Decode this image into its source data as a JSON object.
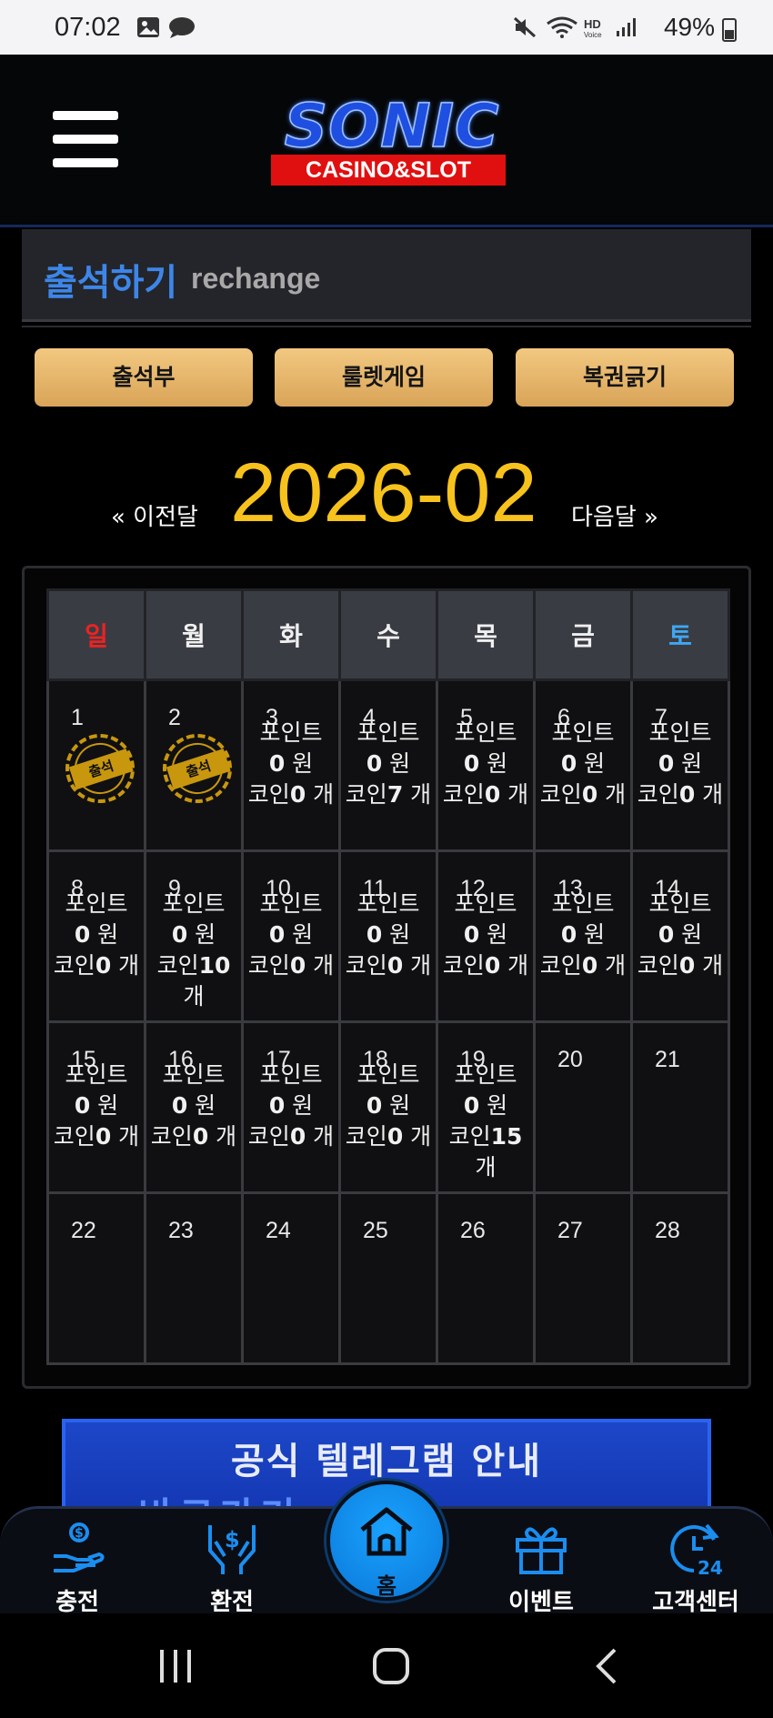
{
  "status_bar": {
    "time": "07:02",
    "battery": "49%",
    "icons": [
      "image-icon",
      "chat-icon",
      "mute-icon",
      "wifi-icon",
      "hd-voice-icon",
      "signal-icon",
      "battery-icon"
    ]
  },
  "header": {
    "menu_icon": "hamburger-menu-icon",
    "logo_main": "SONIC",
    "logo_sub": "CASINO&SLOT"
  },
  "page": {
    "title": "출석하기",
    "subtitle": "rechange"
  },
  "tabs": [
    {
      "label": "출석부"
    },
    {
      "label": "룰렛게임"
    },
    {
      "label": "복권긁기"
    }
  ],
  "month_nav": {
    "prev": "« 이전달",
    "current": "2026-02",
    "next": "다음달 »"
  },
  "calendar": {
    "weekdays": [
      "일",
      "월",
      "화",
      "수",
      "목",
      "금",
      "토"
    ],
    "days": {
      "d1": {
        "num": "1",
        "stamp": "출석"
      },
      "d2": {
        "num": "2",
        "stamp": "출석"
      },
      "d3": {
        "num": "3",
        "point_label": "포인트",
        "point": "0",
        "point_unit": "원",
        "coin_label": "코인",
        "coin": "0",
        "coin_unit": "개"
      },
      "d4": {
        "num": "4",
        "point_label": "포인트",
        "point": "0",
        "point_unit": "원",
        "coin_label": "코인",
        "coin": "7",
        "coin_unit": "개"
      },
      "d5": {
        "num": "5",
        "point_label": "포인트",
        "point": "0",
        "point_unit": "원",
        "coin_label": "코인",
        "coin": "0",
        "coin_unit": "개"
      },
      "d6": {
        "num": "6",
        "point_label": "포인트",
        "point": "0",
        "point_unit": "원",
        "coin_label": "코인",
        "coin": "0",
        "coin_unit": "개"
      },
      "d7": {
        "num": "7",
        "point_label": "포인트",
        "point": "0",
        "point_unit": "원",
        "coin_label": "코인",
        "coin": "0",
        "coin_unit": "개"
      },
      "d8": {
        "num": "8",
        "point_label": "포인트",
        "point": "0",
        "point_unit": "원",
        "coin_label": "코인",
        "coin": "0",
        "coin_unit": "개"
      },
      "d9": {
        "num": "9",
        "point_label": "포인트",
        "point": "0",
        "point_unit": "원",
        "coin_label": "코인",
        "coin": "10",
        "coin_unit": "개"
      },
      "d10": {
        "num": "10",
        "point_label": "포인트",
        "point": "0",
        "point_unit": "원",
        "coin_label": "코인",
        "coin": "0",
        "coin_unit": "개"
      },
      "d11": {
        "num": "11",
        "point_label": "포인트",
        "point": "0",
        "point_unit": "원",
        "coin_label": "코인",
        "coin": "0",
        "coin_unit": "개"
      },
      "d12": {
        "num": "12",
        "point_label": "포인트",
        "point": "0",
        "point_unit": "원",
        "coin_label": "코인",
        "coin": "0",
        "coin_unit": "개"
      },
      "d13": {
        "num": "13",
        "point_label": "포인트",
        "point": "0",
        "point_unit": "원",
        "coin_label": "코인",
        "coin": "0",
        "coin_unit": "개"
      },
      "d14": {
        "num": "14",
        "point_label": "포인트",
        "point": "0",
        "point_unit": "원",
        "coin_label": "코인",
        "coin": "0",
        "coin_unit": "개"
      },
      "d15": {
        "num": "15",
        "point_label": "포인트",
        "point": "0",
        "point_unit": "원",
        "coin_label": "코인",
        "coin": "0",
        "coin_unit": "개"
      },
      "d16": {
        "num": "16",
        "point_label": "포인트",
        "point": "0",
        "point_unit": "원",
        "coin_label": "코인",
        "coin": "0",
        "coin_unit": "개"
      },
      "d17": {
        "num": "17",
        "point_label": "포인트",
        "point": "0",
        "point_unit": "원",
        "coin_label": "코인",
        "coin": "0",
        "coin_unit": "개"
      },
      "d18": {
        "num": "18",
        "point_label": "포인트",
        "point": "0",
        "point_unit": "원",
        "coin_label": "코인",
        "coin": "0",
        "coin_unit": "개"
      },
      "d19": {
        "num": "19",
        "point_label": "포인트",
        "point": "0",
        "point_unit": "원",
        "coin_label": "코인",
        "coin": "15",
        "coin_unit": "개"
      },
      "d20": {
        "num": "20"
      },
      "d21": {
        "num": "21"
      },
      "d22": {
        "num": "22"
      },
      "d23": {
        "num": "23"
      },
      "d24": {
        "num": "24"
      },
      "d25": {
        "num": "25"
      },
      "d26": {
        "num": "26"
      },
      "d27": {
        "num": "27"
      },
      "d28": {
        "num": "28"
      }
    }
  },
  "banner": {
    "title": "공식 텔레그램 안내",
    "partial_text": "바로가기"
  },
  "bottom_nav": {
    "items": [
      {
        "label": "충전",
        "icon": "deposit-hand-coin-icon"
      },
      {
        "label": "환전",
        "icon": "withdraw-hands-dollar-icon"
      },
      {
        "label": "홈",
        "icon": "home-icon"
      },
      {
        "label": "이벤트",
        "icon": "gift-icon"
      },
      {
        "label": "고객센터",
        "icon": "support-24h-icon"
      }
    ]
  },
  "system_nav": {
    "icons": [
      "recent-apps-icon",
      "home-circle-icon",
      "back-icon"
    ]
  },
  "colors": {
    "accent_gold": "#f7c21c",
    "tab_gold": "#e3b56c",
    "title_blue": "#3d86e8",
    "sunday_red": "#ee2222",
    "saturday_blue": "#3fa7f0",
    "nav_blue": "#1a8ef0"
  }
}
